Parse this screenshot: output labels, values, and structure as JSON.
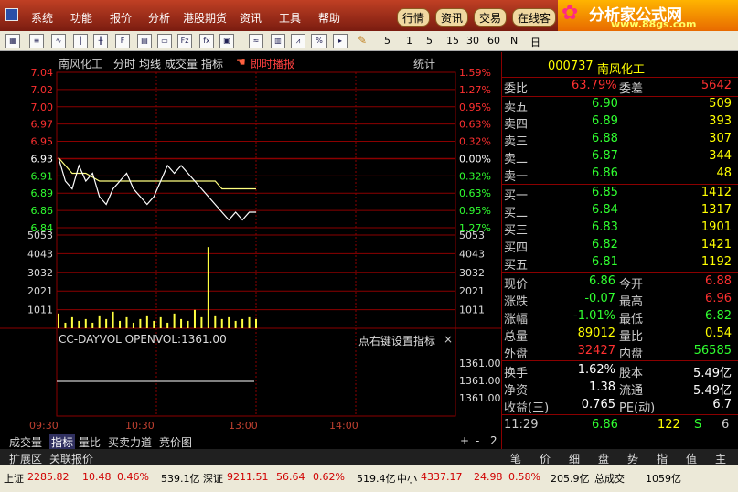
{
  "menu": {
    "items": [
      "系统",
      "功能",
      "报价",
      "分析",
      "港股期货",
      "资讯",
      "工具",
      "帮助"
    ],
    "tabs": [
      "行情",
      "资讯",
      "交易",
      "在线客"
    ]
  },
  "brand": {
    "title": "分析家公式网",
    "url": "www.88gs.com"
  },
  "toolbar": {
    "periods": [
      "5",
      "1",
      "5",
      "15",
      "30",
      "60",
      "N",
      "日"
    ]
  },
  "chart": {
    "title": "南风化工",
    "tabs": [
      "分时",
      "均线",
      "成交量",
      "指标"
    ],
    "live": "即时播报",
    "stats": "统计",
    "price_labels": [
      "7.04",
      "7.02",
      "7.00",
      "6.97",
      "6.95",
      "6.93",
      "6.91",
      "6.89",
      "6.86",
      "6.84"
    ],
    "pct_labels": [
      "1.59%",
      "1.27%",
      "0.95%",
      "0.63%",
      "0.32%",
      "0.00%",
      "0.32%",
      "0.63%",
      "0.95%",
      "1.27%"
    ],
    "vol_labels": [
      "5053",
      "4043",
      "3032",
      "2021",
      "1011"
    ],
    "indicator_title": "CC-DAYVOL  OPENVOL:1361.00",
    "indicator_hint": "点右键设置指标",
    "indicator_values": [
      "1361.00",
      "1361.00",
      "1361.00"
    ],
    "time_labels": [
      "09:30",
      "10:30",
      "13:00",
      "14:00"
    ],
    "colors": {
      "up": "#ff3030",
      "down": "#30ff30",
      "grid": "#8b0000",
      "avg": "#ffff80",
      "price": "#ffffff"
    }
  },
  "chart_data": {
    "type": "line",
    "title": "南风化工",
    "ylim": [
      6.84,
      7.04
    ],
    "preclose": 6.93,
    "price_series": [
      6.93,
      6.9,
      6.89,
      6.92,
      6.9,
      6.91,
      6.88,
      6.87,
      6.89,
      6.9,
      6.91,
      6.89,
      6.88,
      6.87,
      6.88,
      6.9,
      6.92,
      6.91,
      6.92,
      6.91,
      6.9,
      6.89,
      6.88,
      6.87,
      6.86,
      6.85,
      6.86,
      6.85,
      6.86,
      6.86
    ],
    "avg_series": [
      6.93,
      6.92,
      6.91,
      6.91,
      6.91,
      6.905,
      6.9,
      6.9,
      6.9,
      6.9,
      6.9,
      6.9,
      6.9,
      6.9,
      6.9,
      6.9,
      6.9,
      6.9,
      6.9,
      6.9,
      6.9,
      6.9,
      6.9,
      6.9,
      6.89,
      6.89,
      6.89,
      6.89,
      6.89,
      6.89
    ],
    "volumes": [
      800,
      300,
      600,
      400,
      500,
      300,
      700,
      500,
      900,
      400,
      600,
      300,
      500,
      700,
      400,
      600,
      300,
      800,
      500,
      400,
      1000,
      600,
      4400,
      700,
      500,
      600,
      400,
      500,
      600,
      500
    ]
  },
  "quote": {
    "code": "000737",
    "name": "南风化工",
    "weibi_label": "委比",
    "weibi": "63.79%",
    "weicha_label": "委差",
    "weicha": "5642",
    "asks": [
      {
        "label": "卖五",
        "price": "6.90",
        "vol": "509"
      },
      {
        "label": "卖四",
        "price": "6.89",
        "vol": "393"
      },
      {
        "label": "卖三",
        "price": "6.88",
        "vol": "307"
      },
      {
        "label": "卖二",
        "price": "6.87",
        "vol": "344"
      },
      {
        "label": "卖一",
        "price": "6.86",
        "vol": "48"
      }
    ],
    "bids": [
      {
        "label": "买一",
        "price": "6.85",
        "vol": "1412"
      },
      {
        "label": "买二",
        "price": "6.84",
        "vol": "1317"
      },
      {
        "label": "买三",
        "price": "6.83",
        "vol": "1901"
      },
      {
        "label": "买四",
        "price": "6.82",
        "vol": "1421"
      },
      {
        "label": "买五",
        "price": "6.81",
        "vol": "1192"
      }
    ],
    "stats": [
      {
        "l1": "现价",
        "v1": "6.86",
        "l2": "今开",
        "v2": "6.88"
      },
      {
        "l1": "涨跌",
        "v1": "-0.07",
        "l2": "最高",
        "v2": "6.96"
      },
      {
        "l1": "涨幅",
        "v1": "-1.01%",
        "l2": "最低",
        "v2": "6.82"
      },
      {
        "l1": "总量",
        "v1": "89012",
        "l2": "量比",
        "v2": "0.54"
      },
      {
        "l1": "外盘",
        "v1": "32427",
        "l2": "内盘",
        "v2": "56585"
      }
    ],
    "fund": [
      {
        "l1": "换手",
        "v1": "1.62%",
        "l2": "股本",
        "v2": "5.49亿"
      },
      {
        "l1": "净资",
        "v1": "1.38",
        "l2": "流通",
        "v2": "5.49亿"
      },
      {
        "l1": "收益(三)",
        "v1": "0.765",
        "l2": "PE(动)",
        "v2": "6.7"
      }
    ],
    "tick": {
      "time": "11:29",
      "price": "6.86",
      "vol": "122",
      "side": "S",
      "num": "6"
    }
  },
  "bottom_tabs": [
    "成交量",
    "指标",
    "量比",
    "买卖力道",
    "竞价图"
  ],
  "bottom_controls": [
    "+",
    "-",
    "2"
  ],
  "ext_tabs": [
    "扩展区",
    "关联报价"
  ],
  "right_tabs": [
    "笔",
    "价",
    "细",
    "盘",
    "势",
    "指",
    "值",
    "主"
  ],
  "status": {
    "sh_label": "上证",
    "sh": "2285.82",
    "sh_chg": "10.48",
    "sh_pct": "0.46%",
    "sh_amt": "539.1亿",
    "sz_label": "深证",
    "sz": "9211.51",
    "sz_chg": "56.64",
    "sz_pct": "0.62%",
    "sz_amt": "519.4亿",
    "zx_label": "中小",
    "zx": "4337.17",
    "zx_chg": "24.98",
    "zx_pct": "0.58%",
    "zx_amt": "205.9亿",
    "total_label": "总成交",
    "total": "1059亿"
  }
}
